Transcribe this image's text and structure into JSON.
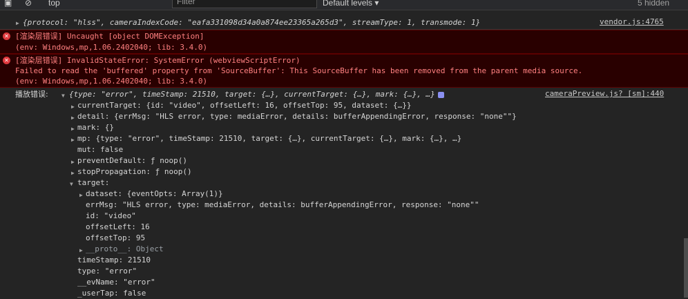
{
  "toolbar": {
    "context": "top",
    "filter_placeholder": "Filter",
    "levels": "Default levels",
    "hidden": "5 hidden"
  },
  "log1": {
    "text": "{protocol: \"hlss\", cameraIndexCode: \"eafa331098d34a0a874ee23365a265d3\", streamType: 1, transmode: 1}",
    "source": "vendor.js:4765"
  },
  "error1": {
    "line1": "[渲染层错误] Uncaught [object DOMException]",
    "line2": "(env: Windows,mp,1.06.2402040; lib: 3.4.0)"
  },
  "error2": {
    "line1": "[渲染层错误] InvalidStateError: SystemError (webviewScriptError)",
    "line2": "Failed to read the 'buffered' property from 'SourceBuffer': This SourceBuffer has been removed from the parent media source.",
    "line3": "(env: Windows,mp,1.06.2402040; lib: 3.4.0)"
  },
  "event": {
    "label": "播放错误:",
    "summary": "{type: \"error\", timeStamp: 21510, target: {…}, currentTarget: {…}, mark: {…}, …}",
    "source": "cameraPreview.js? [sm]:440",
    "props": [
      "currentTarget: {id: \"video\", offsetLeft: 16, offsetTop: 95, dataset: {…}}",
      "detail: {errMsg: \"HLS error, type: mediaError, details: bufferAppendingError, response: \"none\"\"}",
      "mark: {}",
      "mp: {type: \"error\", timeStamp: 21510, target: {…}, currentTarget: {…}, mark: {…}, …}",
      "mut: false",
      "preventDefault: ƒ noop()",
      "stopPropagation: ƒ noop()",
      "target:",
      "dataset: {eventOpts: Array(1)}",
      "errMsg: \"HLS error, type: mediaError, details: bufferAppendingError, response: \"none\"\"",
      "id: \"video\"",
      "offsetLeft: 16",
      "offsetTop: 95",
      "__proto__: Object",
      "timeStamp: 21510",
      "type: \"error\"",
      "__evName: \"error\"",
      "_userTap: false"
    ]
  }
}
